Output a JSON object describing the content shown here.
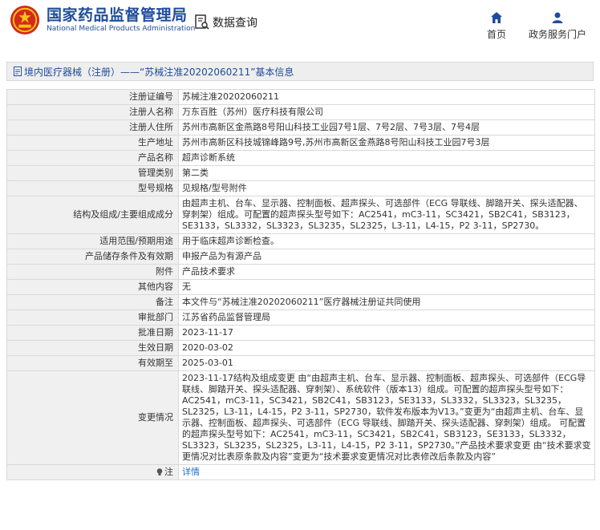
{
  "header": {
    "brand_cn": "国家药品监督管理局",
    "brand_en": "National Medical Products Administration",
    "query_label": "数据查询",
    "nav": [
      {
        "label": "首页",
        "icon": "home-icon"
      },
      {
        "label": "政务服务门户",
        "icon": "user-icon"
      }
    ]
  },
  "title": "境内医疗器械（注册）——“苏械注准20202060211”基本信息",
  "rows": [
    {
      "label": "注册证编号",
      "value": "苏械注准20202060211"
    },
    {
      "label": "注册人名称",
      "value": "万东百胜（苏州）医疗科技有限公司"
    },
    {
      "label": "注册人住所",
      "value": "苏州市高新区金燕路8号阳山科技工业园7号1层、7号2层、7号3层、7号4层"
    },
    {
      "label": "生产地址",
      "value": "苏州市高新区科技城锦峰路9号,苏州市高新区金燕路8号阳山科技工业园7号3层"
    },
    {
      "label": "产品名称",
      "value": "超声诊断系统"
    },
    {
      "label": "管理类别",
      "value": "第二类"
    },
    {
      "label": "型号规格",
      "value": "见规格/型号附件"
    },
    {
      "label": "结构及组成/主要组成成分",
      "value": "由超声主机、台车、显示器、控制面板、超声探头、可选部件（ECG 导联线、脚踏开关、探头适配器、穿刺架）组成。可配置的超声探头型号如下：AC2541，mC3-11，SC3421，SB2C41，SB3123，SE3133，SL3332，SL3323，SL3235，SL2325，L3-11，L4-15，P2 3-11，SP2730。"
    },
    {
      "label": "适用范围/预期用途",
      "value": "用于临床超声诊断检查。"
    },
    {
      "label": "产品储存条件及有效期",
      "value": "申报产品为有源产品"
    },
    {
      "label": "附件",
      "value": "产品技术要求"
    },
    {
      "label": "其他内容",
      "value": "无"
    },
    {
      "label": "备注",
      "value": "本文件与“苏械注准20202060211”医疗器械注册证共同使用"
    },
    {
      "label": "审批部门",
      "value": "江苏省药品监督管理局"
    },
    {
      "label": "批准日期",
      "value": "2023-11-17"
    },
    {
      "label": "生效日期",
      "value": "2020-03-02"
    },
    {
      "label": "有效期至",
      "value": "2025-03-01"
    },
    {
      "label": "变更情况",
      "value": "2023-11-17结构及组成变更 由“由超声主机、台车、显示器、控制面板、超声探头、可选部件（ECG导联线、脚踏开关、探头适配器、穿刺架）、系统软件（版本13）组成。可配置的超声探头型号如下：AC2541，mC3-11，SC3421，SB2C41，SB3123，SE3133，SL3332，SL3323，SL3235，SL2325，L3-11，L4-15，P2 3-11，SP2730，软件发布版本为V13。”变更为“由超声主机、台车、显示器、控制面板、超声探头、可选部件（ECG 导联线、脚踏开关、探头适配器、穿刺架）组成。 可配置的超声探头型号如下：AC2541，mC3-11，SC3421，SB2C41，SB3123，SE3133，SL3332，SL3323，SL3235，SL2325，L3-11，L4-15，P2 3-11，SP2730。”产品技术要求变更 由“技术要求变更情况对比表原条款及内容”变更为“技术要求变更情况对比表修改后条款及内容”"
    }
  ],
  "note": {
    "label": "注",
    "link": "详情"
  },
  "colors": {
    "brand": "#1f4c9c",
    "link": "#1f6fc6",
    "label_bg": "#f0f0f0"
  }
}
